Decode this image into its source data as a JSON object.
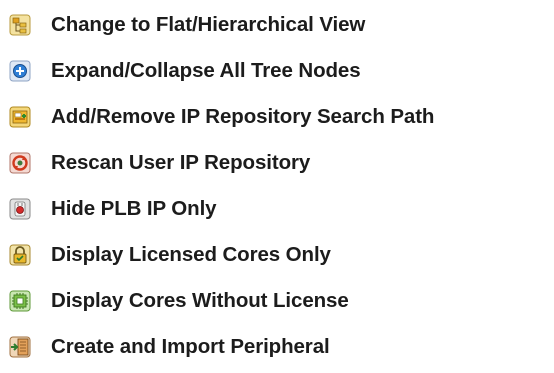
{
  "legend": {
    "items": [
      {
        "icon": "flat-hierarchical-view-icon",
        "label": "Change to Flat/Hierarchical View"
      },
      {
        "icon": "expand-collapse-icon",
        "label": "Expand/Collapse All Tree Nodes"
      },
      {
        "icon": "repository-search-path-icon",
        "label": "Add/Remove IP Repository Search Path"
      },
      {
        "icon": "rescan-icon",
        "label": "Rescan User IP Repository"
      },
      {
        "icon": "hide-plb-icon",
        "label": "Hide PLB IP Only"
      },
      {
        "icon": "licensed-cores-lock-icon",
        "label": "Display Licensed Cores Only"
      },
      {
        "icon": "cores-without-license-icon",
        "label": "Display Cores Without License"
      },
      {
        "icon": "create-import-peripheral-icon",
        "label": "Create and Import Peripheral"
      }
    ]
  }
}
